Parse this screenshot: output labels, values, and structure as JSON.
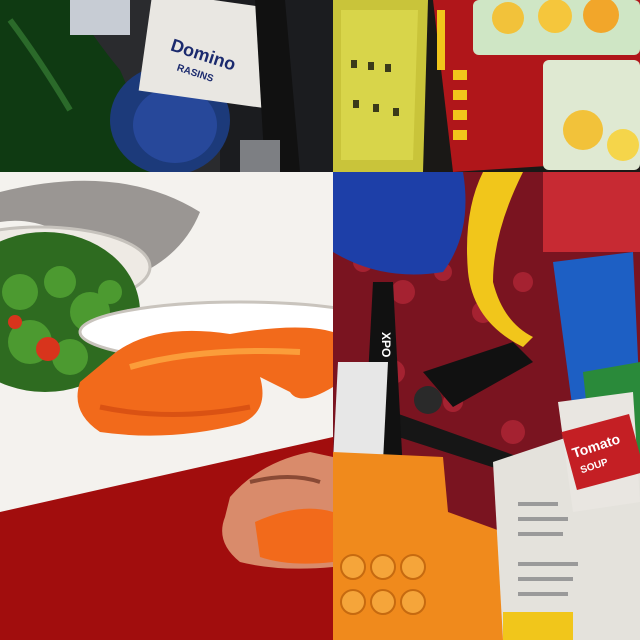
{
  "image": {
    "description_tiles": [
      "pantry-shelf",
      "cereal-boxes",
      "pizza-plate",
      "toy-clutter"
    ]
  },
  "visible_text": {
    "salt_box": "Domino",
    "salt_box_sub": "RASINS",
    "soup_can_line1": "Tomato",
    "soup_can_line2": "SOUP",
    "marker_label": "XPO"
  },
  "colors": {
    "brand_red": "#b0161a",
    "plate_white": "#f4f2ee",
    "pizza_orange": "#f26a1b",
    "lego_orange": "#f08a1c",
    "banana_yellow": "#f1c61b",
    "block_blue": "#1d5fc4"
  }
}
